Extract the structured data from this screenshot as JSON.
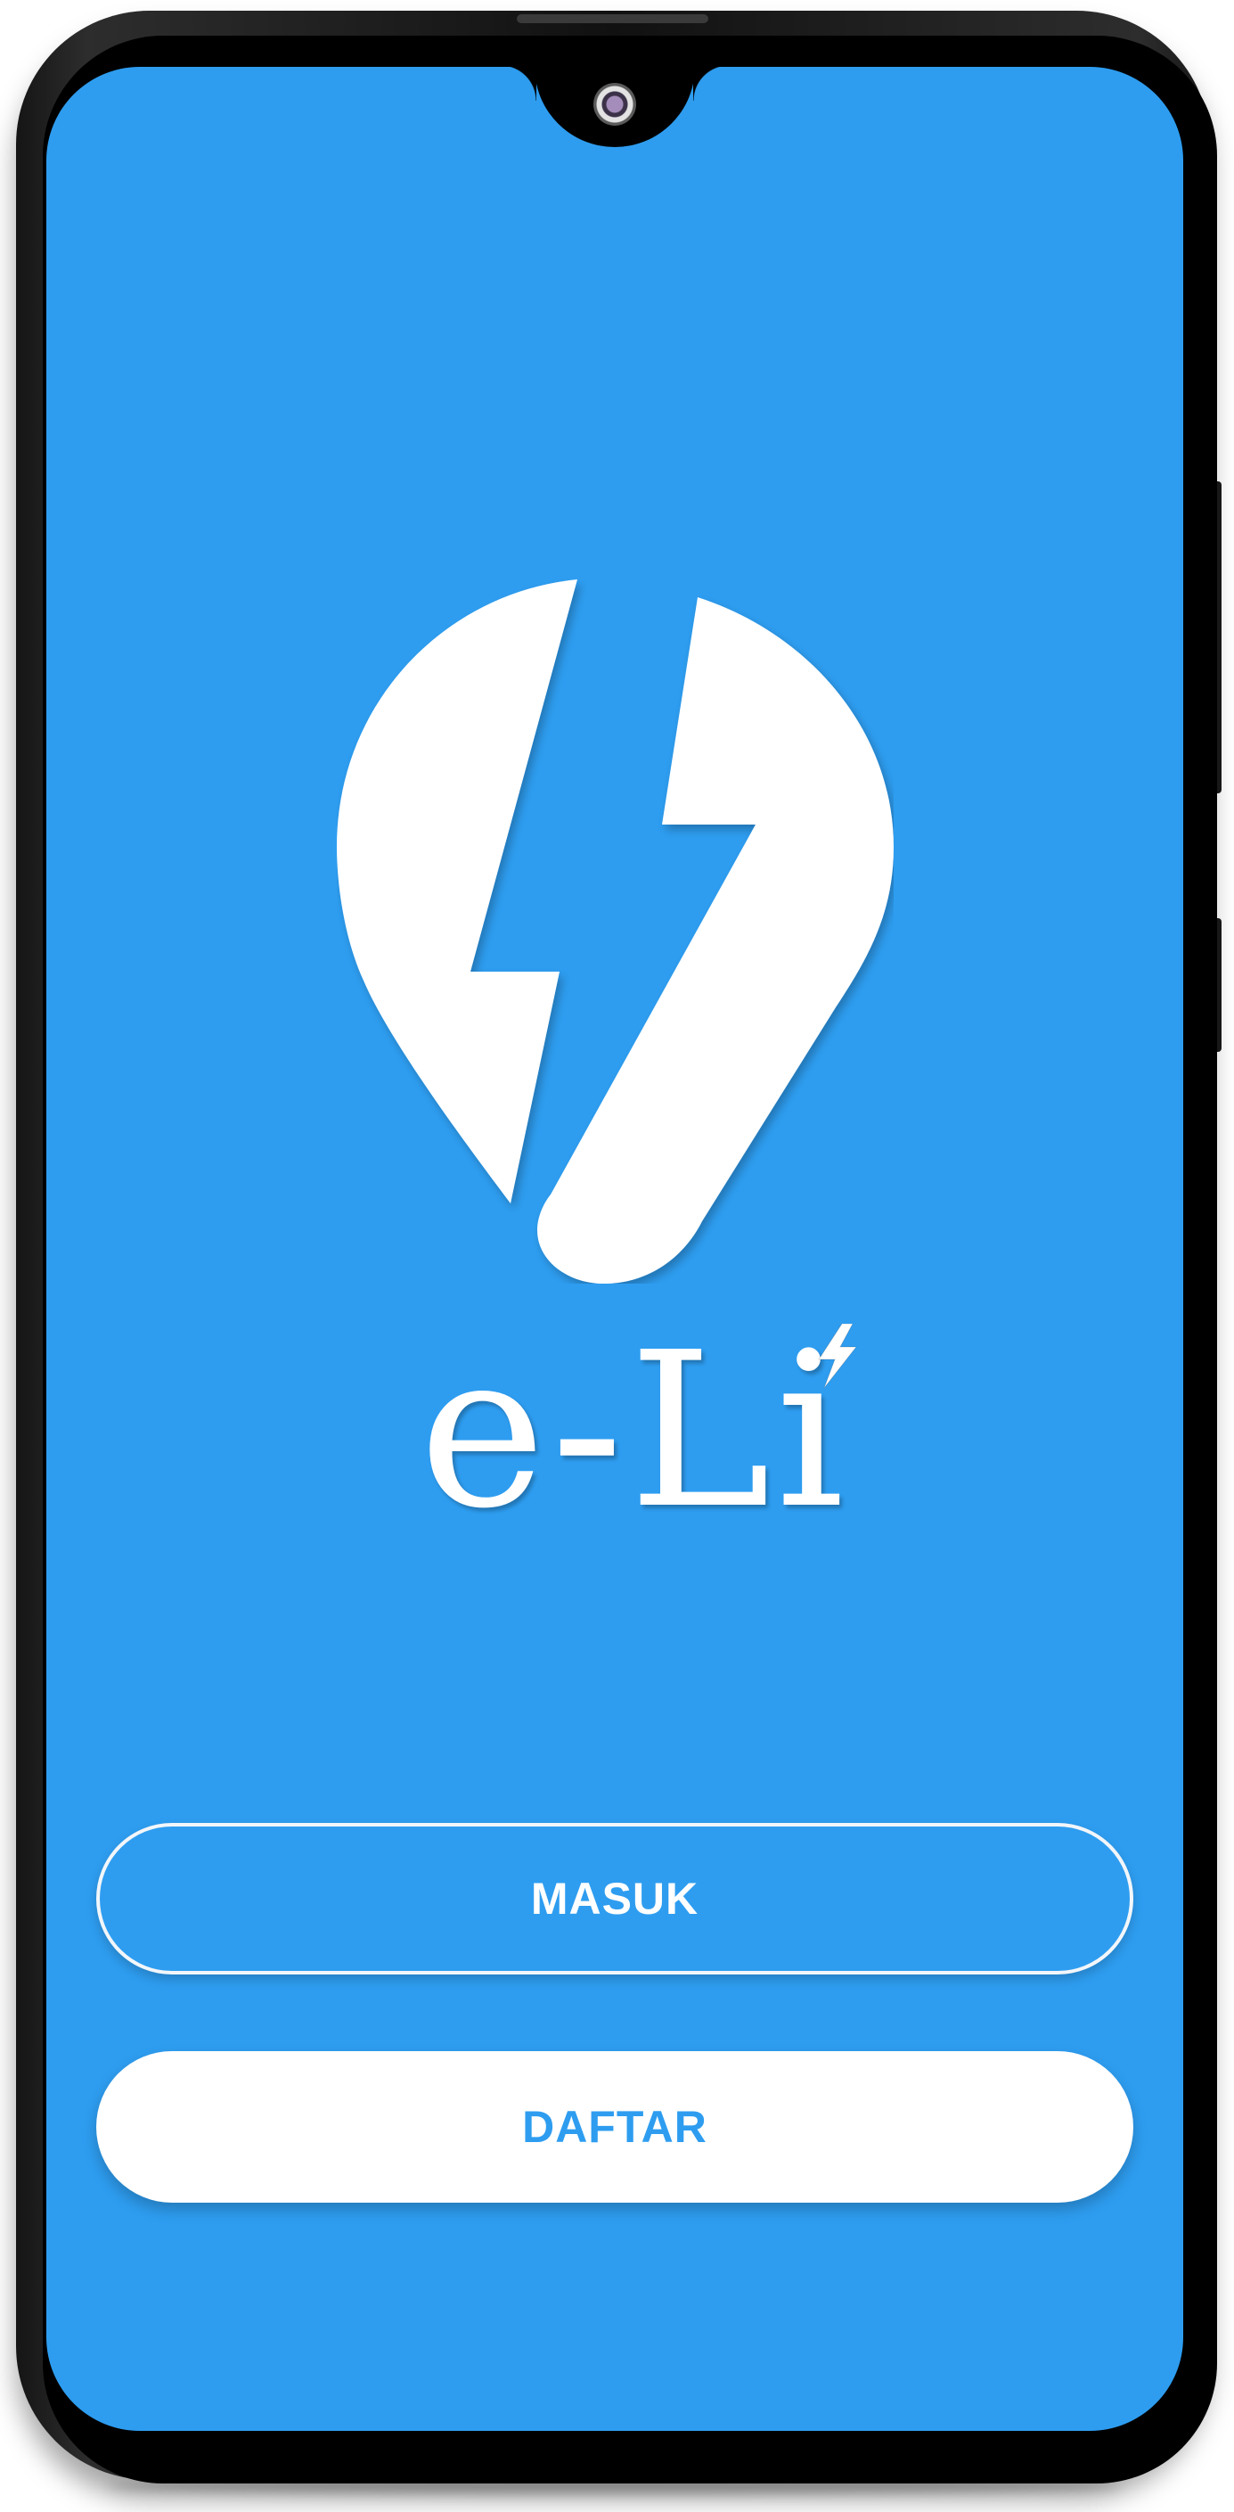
{
  "app": {
    "brand_name": "e-Li",
    "wordmark_main": "e-L",
    "wordmark_suffix": "i"
  },
  "buttons": {
    "login_label": "MASUK",
    "register_label": "DAFTAR"
  },
  "colors": {
    "primary": "#2e9df0",
    "on_primary": "#ffffff"
  },
  "icons": {
    "logo": "map-pin-lightning-icon",
    "wordmark_accent": "lightning-bolt-icon"
  }
}
